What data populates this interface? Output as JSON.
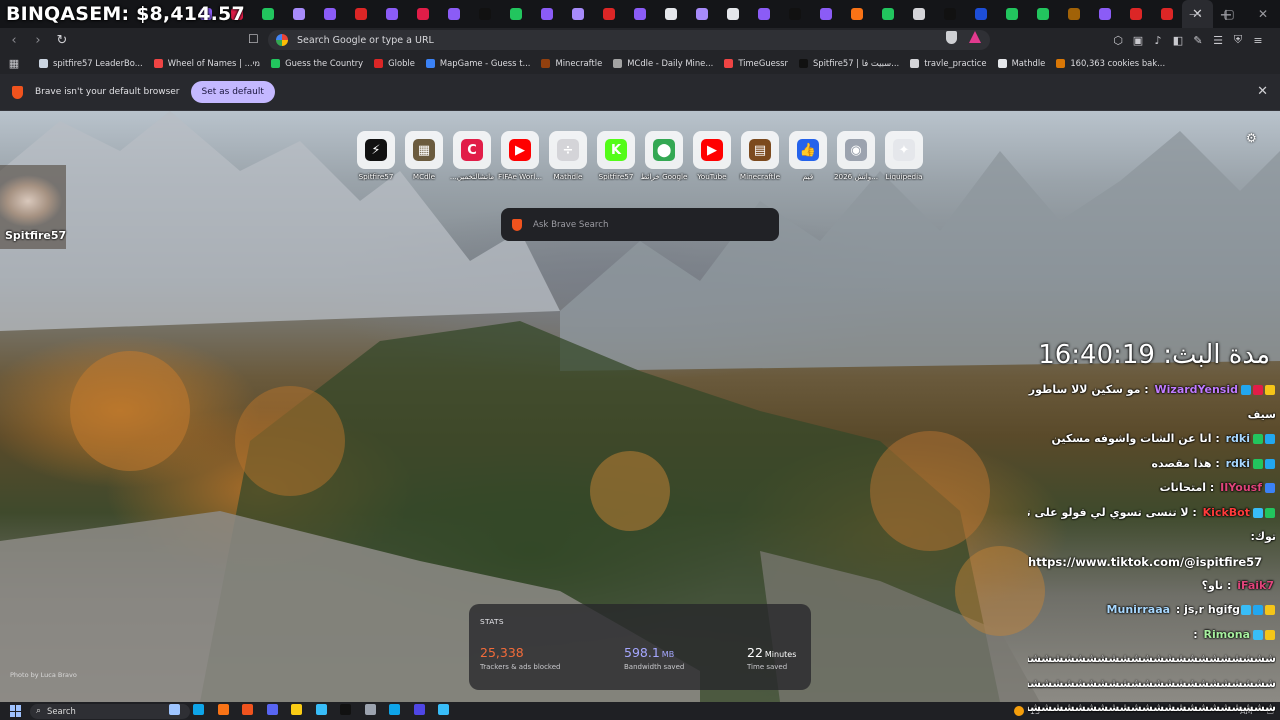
{
  "overlay": {
    "title": "BINQASEM: $8,414.57"
  },
  "tabs": {
    "favicon_colors": [
      "#8b5cf6",
      "#e11d48",
      "#22c55e",
      "#a78bfa",
      "#8b5cf6",
      "#dc2626",
      "#8b5cf6",
      "#e11d48",
      "#8b5cf6",
      "#111111",
      "#22c55e",
      "#8b5cf6",
      "#a78bfa",
      "#dc2626",
      "#8b5cf6",
      "#e5e7eb",
      "#a78bfa",
      "#e5e7eb",
      "#8b5cf6",
      "#111111",
      "#8b5cf6",
      "#f97316",
      "#22c55e",
      "#d4d4d8",
      "#111111",
      "#1d4ed8",
      "#22c55e",
      "#22c55e",
      "#a16207",
      "#8b5cf6",
      "#dc2626",
      "#dc2626"
    ],
    "close_glyph": "✕",
    "new_tab_glyph": "+"
  },
  "toolbar": {
    "back": "‹",
    "forward": "›",
    "reload": "↻",
    "bookmark": "☐",
    "omnibox_placeholder": "Search Google or type a URL",
    "right_icons": [
      "⬡",
      "▣",
      "♪",
      "◧",
      "✎",
      "☰",
      "⛨",
      "≡"
    ]
  },
  "bookmarks": [
    {
      "label": "spitfire57 LeaderBo...",
      "color": "#cbd5e1"
    },
    {
      "label": "Wheel of Names | ...מי",
      "color": "#ef4444"
    },
    {
      "label": "Guess the Country",
      "color": "#22c55e"
    },
    {
      "label": "Globle",
      "color": "#dc2626"
    },
    {
      "label": "MapGame - Guess t...",
      "color": "#3b82f6"
    },
    {
      "label": "Minecraftle",
      "color": "#92400e"
    },
    {
      "label": "MCdle - Daily Mine...",
      "color": "#a3a3a3"
    },
    {
      "label": "TimeGuessr",
      "color": "#ef4444"
    },
    {
      "label": "Spitfire57 | سبيت فا...",
      "color": "#111111"
    },
    {
      "label": "travle_practice",
      "color": "#d4d4d8"
    },
    {
      "label": "Mathdle",
      "color": "#e5e7eb"
    },
    {
      "label": "160,363 cookies bak...",
      "color": "#d97706"
    }
  ],
  "infobar": {
    "message": "Brave isn't your default browser",
    "button": "Set as default",
    "close": "✕"
  },
  "ntp": {
    "settings_glyph": "⚙",
    "tiles": [
      {
        "label": "Spitfire57",
        "glyph": "⚡",
        "bg": "#111111"
      },
      {
        "label": "MCdle",
        "glyph": "▦",
        "bg": "#6b5b3e"
      },
      {
        "label": "...ماتشالتخمين",
        "glyph": "C",
        "bg": "#e11d48"
      },
      {
        "label": "FIFAe Worl...",
        "glyph": "▶",
        "bg": "#ff0000"
      },
      {
        "label": "Mathdle",
        "glyph": "÷",
        "bg": "#d4d4d8"
      },
      {
        "label": "Spitfire57",
        "glyph": "K",
        "bg": "#53fc18"
      },
      {
        "label": "خرائط Google",
        "glyph": "⬤",
        "bg": "#34a853"
      },
      {
        "label": "YouTube",
        "glyph": "▶",
        "bg": "#ff0000"
      },
      {
        "label": "Minecraftle",
        "glyph": "▤",
        "bg": "#7c4a1e"
      },
      {
        "label": "قيم",
        "glyph": "👍",
        "bg": "#2563eb"
      },
      {
        "label": "2026 واتش...",
        "glyph": "◉",
        "bg": "#9ca3af"
      },
      {
        "label": "Liquipedia",
        "glyph": "✦",
        "bg": "#e5e7eb"
      }
    ],
    "search_placeholder": "Ask Brave Search",
    "webcam_label": "Spitfire57",
    "photo_credit": "Photo by Luca Bravo",
    "stats": {
      "title": "STATS",
      "trackers": {
        "value": "25,338",
        "caption": "Trackers & ads blocked",
        "color": "#f26b3a"
      },
      "bandwidth": {
        "value": "598.1",
        "unit": "MB",
        "caption": "Bandwidth saved",
        "color": "#a5a7ff"
      },
      "time": {
        "value": "22",
        "unit": "Minutes",
        "caption": "Time saved",
        "color": "#ffffff"
      }
    }
  },
  "stream": {
    "timer": "مدة البث: 16:40:19",
    "chat": [
      {
        "user": "WizardYensid",
        "user_color": "#c07bff",
        "badges": [
          "#f5c518",
          "#e11d48",
          "#22a7f0"
        ],
        "message": "مو سكين لالا ساطور",
        "continuation": "سيف"
      },
      {
        "user": "rdki",
        "user_color": "#a8d8ff",
        "badges": [
          "#22a7f0",
          "#22c55e"
        ],
        "message": "انا عن الشات واشوفه مسكين",
        "continuation": ""
      },
      {
        "user": "rdki",
        "user_color": "#a8d8ff",
        "badges": [
          "#22a7f0",
          "#22c55e"
        ],
        "message": "هذا مقصده",
        "continuation": ""
      },
      {
        "user": "IIYousf",
        "user_color": "#e0457b",
        "badges": [
          "#3b82f6"
        ],
        "message": "امتحانات",
        "continuation": ""
      },
      {
        "user": "KickBot",
        "user_color": "#ff3b3b",
        "badges": [
          "#22c55e",
          "#38bdf8"
        ],
        "message": "لا تنسى تسوي لي فولو على تيك",
        "continuation": "توك:"
      },
      {
        "user": "",
        "user_color": "#ffffff",
        "badges": [],
        "message": "",
        "continuation": "https://www.tiktok.com/@ispitfire57"
      },
      {
        "user": "iFaik7",
        "user_color": "#e0457b",
        "badges": [],
        "message": "ناو؟",
        "continuation": ""
      },
      {
        "user": "Munirraaa",
        "user_color": "#a8d8ff",
        "badges": [
          "#f5c518",
          "#22a7f0",
          "#38bdf8"
        ],
        "message": "js,r hgifg",
        "continuation": ""
      },
      {
        "user": "Rimona",
        "user_color": "#a8f0a0",
        "badges": [
          "#f5c518",
          "#38bdf8"
        ],
        "message": "",
        "continuation": "ششششششششششششششششششششششششششششش"
      }
    ],
    "extra_lines": [
      "ششششششششششششششششششششششششششششش",
      "ششششششششششششششششششششششششششششش"
    ]
  },
  "taskbar": {
    "search_label": "Search",
    "search_glyph": "⌕",
    "app_colors": [
      "#9ec5ff",
      "#0ea5e9",
      "#f97316",
      "#f0531e",
      "#5865f2",
      "#facc15",
      "#38bdf8",
      "#111111",
      "#9ca3af",
      "#0ea5e9",
      "#4f46e5",
      "#38bdf8"
    ],
    "tray_text": "13",
    "clock_text": "AM"
  }
}
